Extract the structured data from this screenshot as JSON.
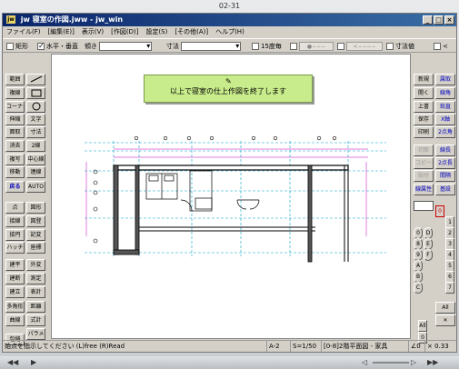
{
  "outer": {
    "title": "02-31"
  },
  "window": {
    "title": "jw 寝室の作図.jww - jw_win",
    "icon_label": "jw",
    "controls": [
      "_",
      "□",
      "×"
    ]
  },
  "menu": [
    "ファイル(F)",
    "[編集(E)]",
    "表示(V)",
    "[作図(D)]",
    "設定(S)",
    "[その他(A)]",
    "ヘルプ(H)"
  ],
  "toolbar": {
    "rect": "矩形",
    "horiz_vert": "水平・垂直",
    "slope_label": "傾き",
    "dim_label": "寸法",
    "angle15": "15度毎",
    "dim_value": "寸法値"
  },
  "left_buttons": [
    "範囲",
    "複線",
    "コーナー",
    "伸縮",
    "面取",
    "消去",
    "複写",
    "移動",
    "戻る",
    "点",
    "接線",
    "接円",
    "ハッチ",
    "建平",
    "建断",
    "建立",
    "多角形",
    "曲線",
    "包絡",
    "分割",
    "文字",
    "寸法",
    "2線",
    "中心線",
    "連線",
    "AUTO",
    "図形",
    "図登",
    "記変",
    "座標",
    "外変",
    "測定",
    "表計",
    "距離",
    "式計",
    "パラメ"
  ],
  "right_buttons": [
    "新規",
    "開く",
    "上書",
    "保存",
    "印刷",
    "切取",
    "コピー",
    "貼付",
    "線属性",
    "属取",
    "線角",
    "鉛直",
    "X軸",
    "2点角",
    "線長",
    "2点長",
    "間隔",
    "基設",
    "All"
  ],
  "layer_buttons": [
    "0",
    "1",
    "2",
    "3",
    "4",
    "5",
    "6",
    "7",
    "8",
    "9",
    "A",
    "B",
    "C",
    "D",
    "E",
    "F"
  ],
  "message": "以上で寝室の仕上作図を終了します",
  "status": {
    "hint": "始点を指示してください (L)free (R)Read",
    "paper": "A-2",
    "scale": "S=1/50",
    "layer": "[0-8]2階平面図 - 家具",
    "angle": "∠0",
    "zoom": "× 0.33"
  },
  "colors": {
    "message_bg": "#c8ec8b",
    "drawing_line": "#000000",
    "grid_line": "#00a0c8",
    "dim_line": "#c000c0"
  }
}
